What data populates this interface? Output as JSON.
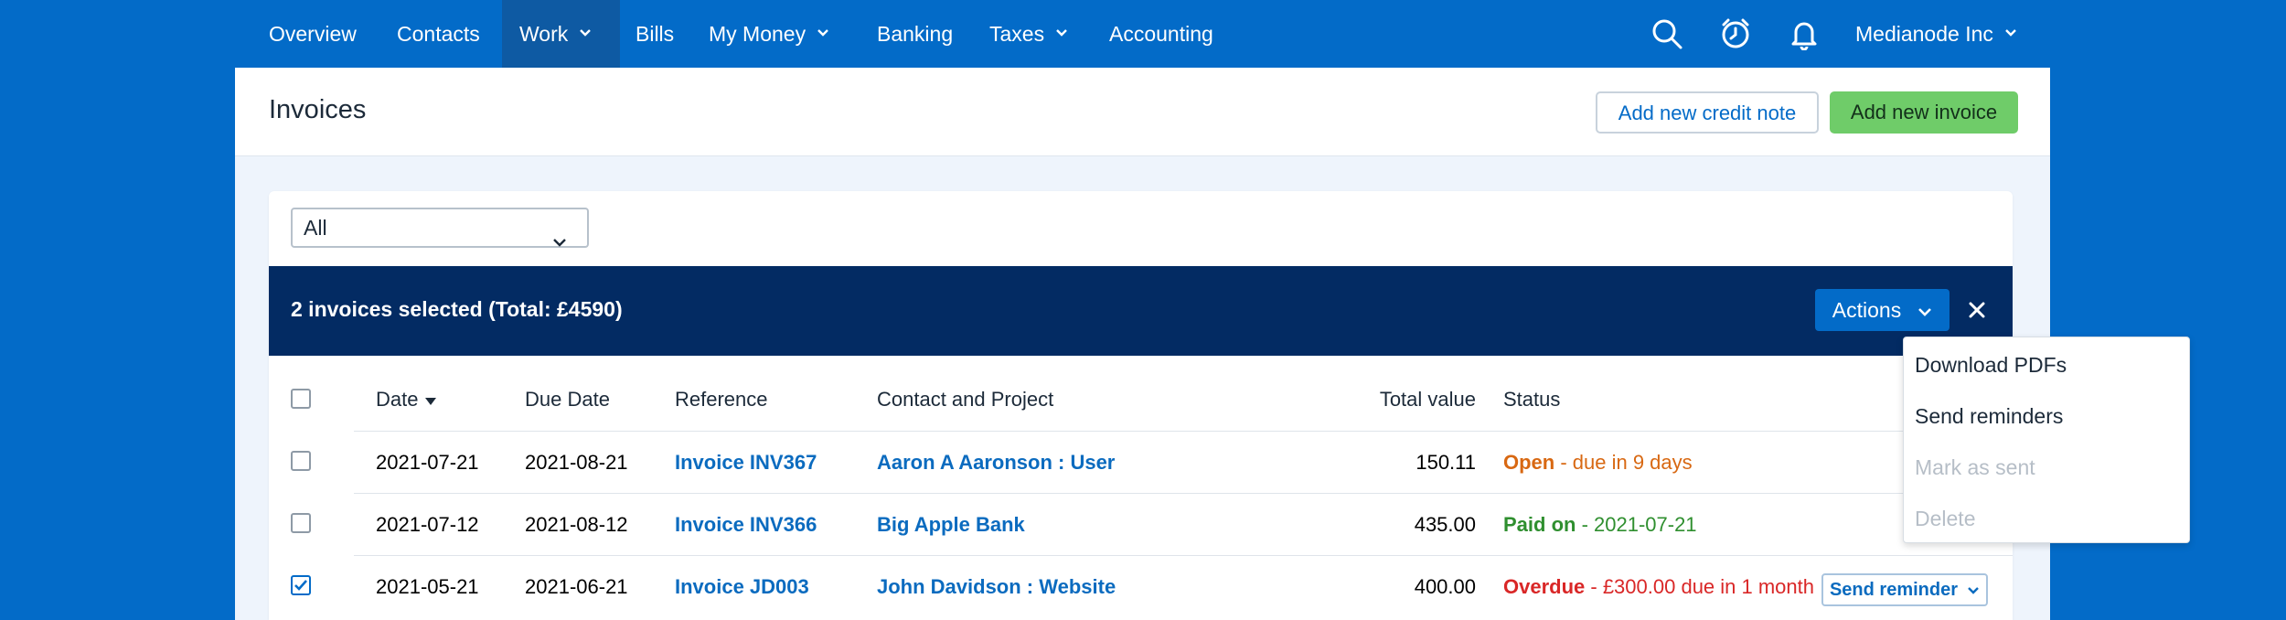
{
  "nav": {
    "items": [
      {
        "label": "Overview",
        "has_dropdown": false
      },
      {
        "label": "Contacts",
        "has_dropdown": false
      },
      {
        "label": "Work",
        "has_dropdown": true,
        "active": true
      },
      {
        "label": "Bills",
        "has_dropdown": false
      },
      {
        "label": "My Money",
        "has_dropdown": true
      },
      {
        "label": "Banking",
        "has_dropdown": false
      },
      {
        "label": "Taxes",
        "has_dropdown": true
      },
      {
        "label": "Accounting",
        "has_dropdown": false
      }
    ],
    "icons": [
      "search-icon",
      "timer-icon",
      "bell-icon"
    ],
    "company": "Medianode Inc"
  },
  "header": {
    "title": "Invoices",
    "add_credit_note": "Add new credit note",
    "add_invoice": "Add new invoice"
  },
  "filter": {
    "selected": "All"
  },
  "selection": {
    "summary": "2 invoices selected (Total: £4590)",
    "actions_label": "Actions"
  },
  "table": {
    "columns": [
      "Date",
      "Due Date",
      "Reference",
      "Contact and Project",
      "Total value",
      "Status"
    ],
    "sort_column": "Date",
    "rows": [
      {
        "checked": false,
        "date": "2021-07-21",
        "due_date": "2021-08-21",
        "reference": "Invoice INV367",
        "contact": "Aaron A Aaronson : User",
        "total": "150.11",
        "status": "Open",
        "status_detail": " - due in 9 days"
      },
      {
        "checked": false,
        "date": "2021-07-12",
        "due_date": "2021-08-12",
        "reference": "Invoice INV366",
        "contact": "Big Apple Bank",
        "total": "435.00",
        "status": "Paid on",
        "status_detail": " - 2021-07-21"
      },
      {
        "checked": true,
        "date": "2021-05-21",
        "due_date": "2021-06-21",
        "reference": "Invoice JD003",
        "contact": "John Davidson : Website",
        "total": "400.00",
        "status": "Overdue",
        "status_detail": " - £300.00 due in 1 month",
        "row_action": "Send reminder"
      }
    ]
  },
  "actions_menu": {
    "items": [
      {
        "label": "Download PDFs",
        "disabled": false
      },
      {
        "label": "Send reminders",
        "disabled": false
      },
      {
        "label": "Mark as sent",
        "disabled": true
      },
      {
        "label": "Delete",
        "disabled": true
      }
    ]
  },
  "colors": {
    "brand_blue": "#036bc8",
    "selection_bar": "#032b63",
    "primary_green": "#6fcc69",
    "status_open": "#d86812",
    "status_paid": "#2f8f2f",
    "status_overdue": "#d92727"
  }
}
